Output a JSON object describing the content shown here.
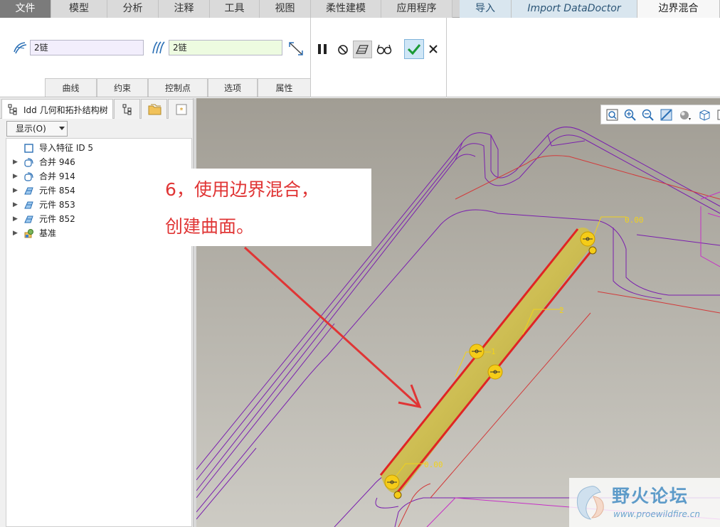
{
  "tabs": [
    {
      "label": "文件"
    },
    {
      "label": "模型"
    },
    {
      "label": "分析"
    },
    {
      "label": "注释"
    },
    {
      "label": "工具"
    },
    {
      "label": "视图"
    },
    {
      "label": "柔性建模"
    },
    {
      "label": "应用程序"
    },
    {
      "label": "导入"
    },
    {
      "label": "Import DataDoctor"
    },
    {
      "label": "边界混合"
    }
  ],
  "ribbon": {
    "first_direction_value": "2链",
    "second_direction_value": "2链",
    "subtabs": [
      "曲线",
      "约束",
      "控制点",
      "选项",
      "属性"
    ]
  },
  "panel": {
    "tab_title": "Idd 几何和拓扑结构树",
    "show_label": "显示(O)",
    "tree": [
      {
        "label": "导入特征 ID 5",
        "expandable": false,
        "icon": "import-feature-icon"
      },
      {
        "label": "合并 946",
        "expandable": true,
        "icon": "merge-icon"
      },
      {
        "label": "合并 914",
        "expandable": true,
        "icon": "merge-icon"
      },
      {
        "label": "元件 854",
        "expandable": true,
        "icon": "component-icon"
      },
      {
        "label": "元件 853",
        "expandable": true,
        "icon": "component-icon"
      },
      {
        "label": "元件 852",
        "expandable": true,
        "icon": "component-icon"
      },
      {
        "label": "基准",
        "expandable": true,
        "icon": "datum-icon"
      }
    ]
  },
  "callout": {
    "line1": "6，使用边界混合，",
    "line2": "创建曲面。"
  },
  "viewport": {
    "dim_label_top": "0.00",
    "dim_label_bottom": "0.00",
    "curve_label_1": "1",
    "curve_label_2": "2"
  },
  "watermark": {
    "brand": "野火论坛",
    "url": "www.proewildfire.cn"
  },
  "colors": {
    "accent_red": "#e03535",
    "surface_yellow": "#d2c25a",
    "wireframe_purple": "#7a1fae",
    "viewport_top": "#a19d94",
    "viewport_bottom": "#cdcbc4"
  }
}
